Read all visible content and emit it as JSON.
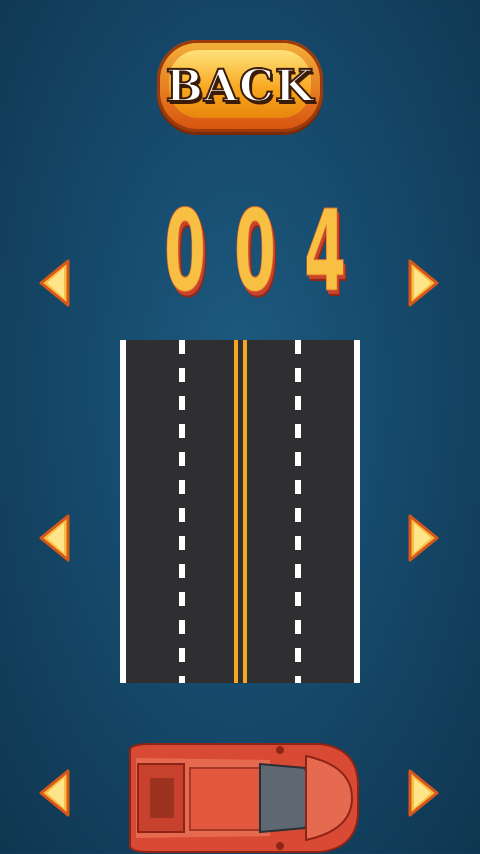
{
  "back_button": {
    "label": "BACK"
  },
  "level_counter": {
    "digits": [
      "0",
      "0",
      "4"
    ]
  },
  "selectors": [
    {
      "name": "digit",
      "left_icon": "arrow-left-icon",
      "right_icon": "arrow-right-icon"
    },
    {
      "name": "road",
      "left_icon": "arrow-left-icon",
      "right_icon": "arrow-right-icon"
    },
    {
      "name": "car",
      "left_icon": "arrow-left-icon",
      "right_icon": "arrow-right-icon"
    }
  ],
  "road": {
    "lanes": 4,
    "line_color": "#ffffff",
    "center_line_color": "#f5a623"
  },
  "car": {
    "color": "#e0513a"
  },
  "colors": {
    "background": "#164a6c",
    "accent": "#f7c043",
    "button": "#f7a41c"
  }
}
